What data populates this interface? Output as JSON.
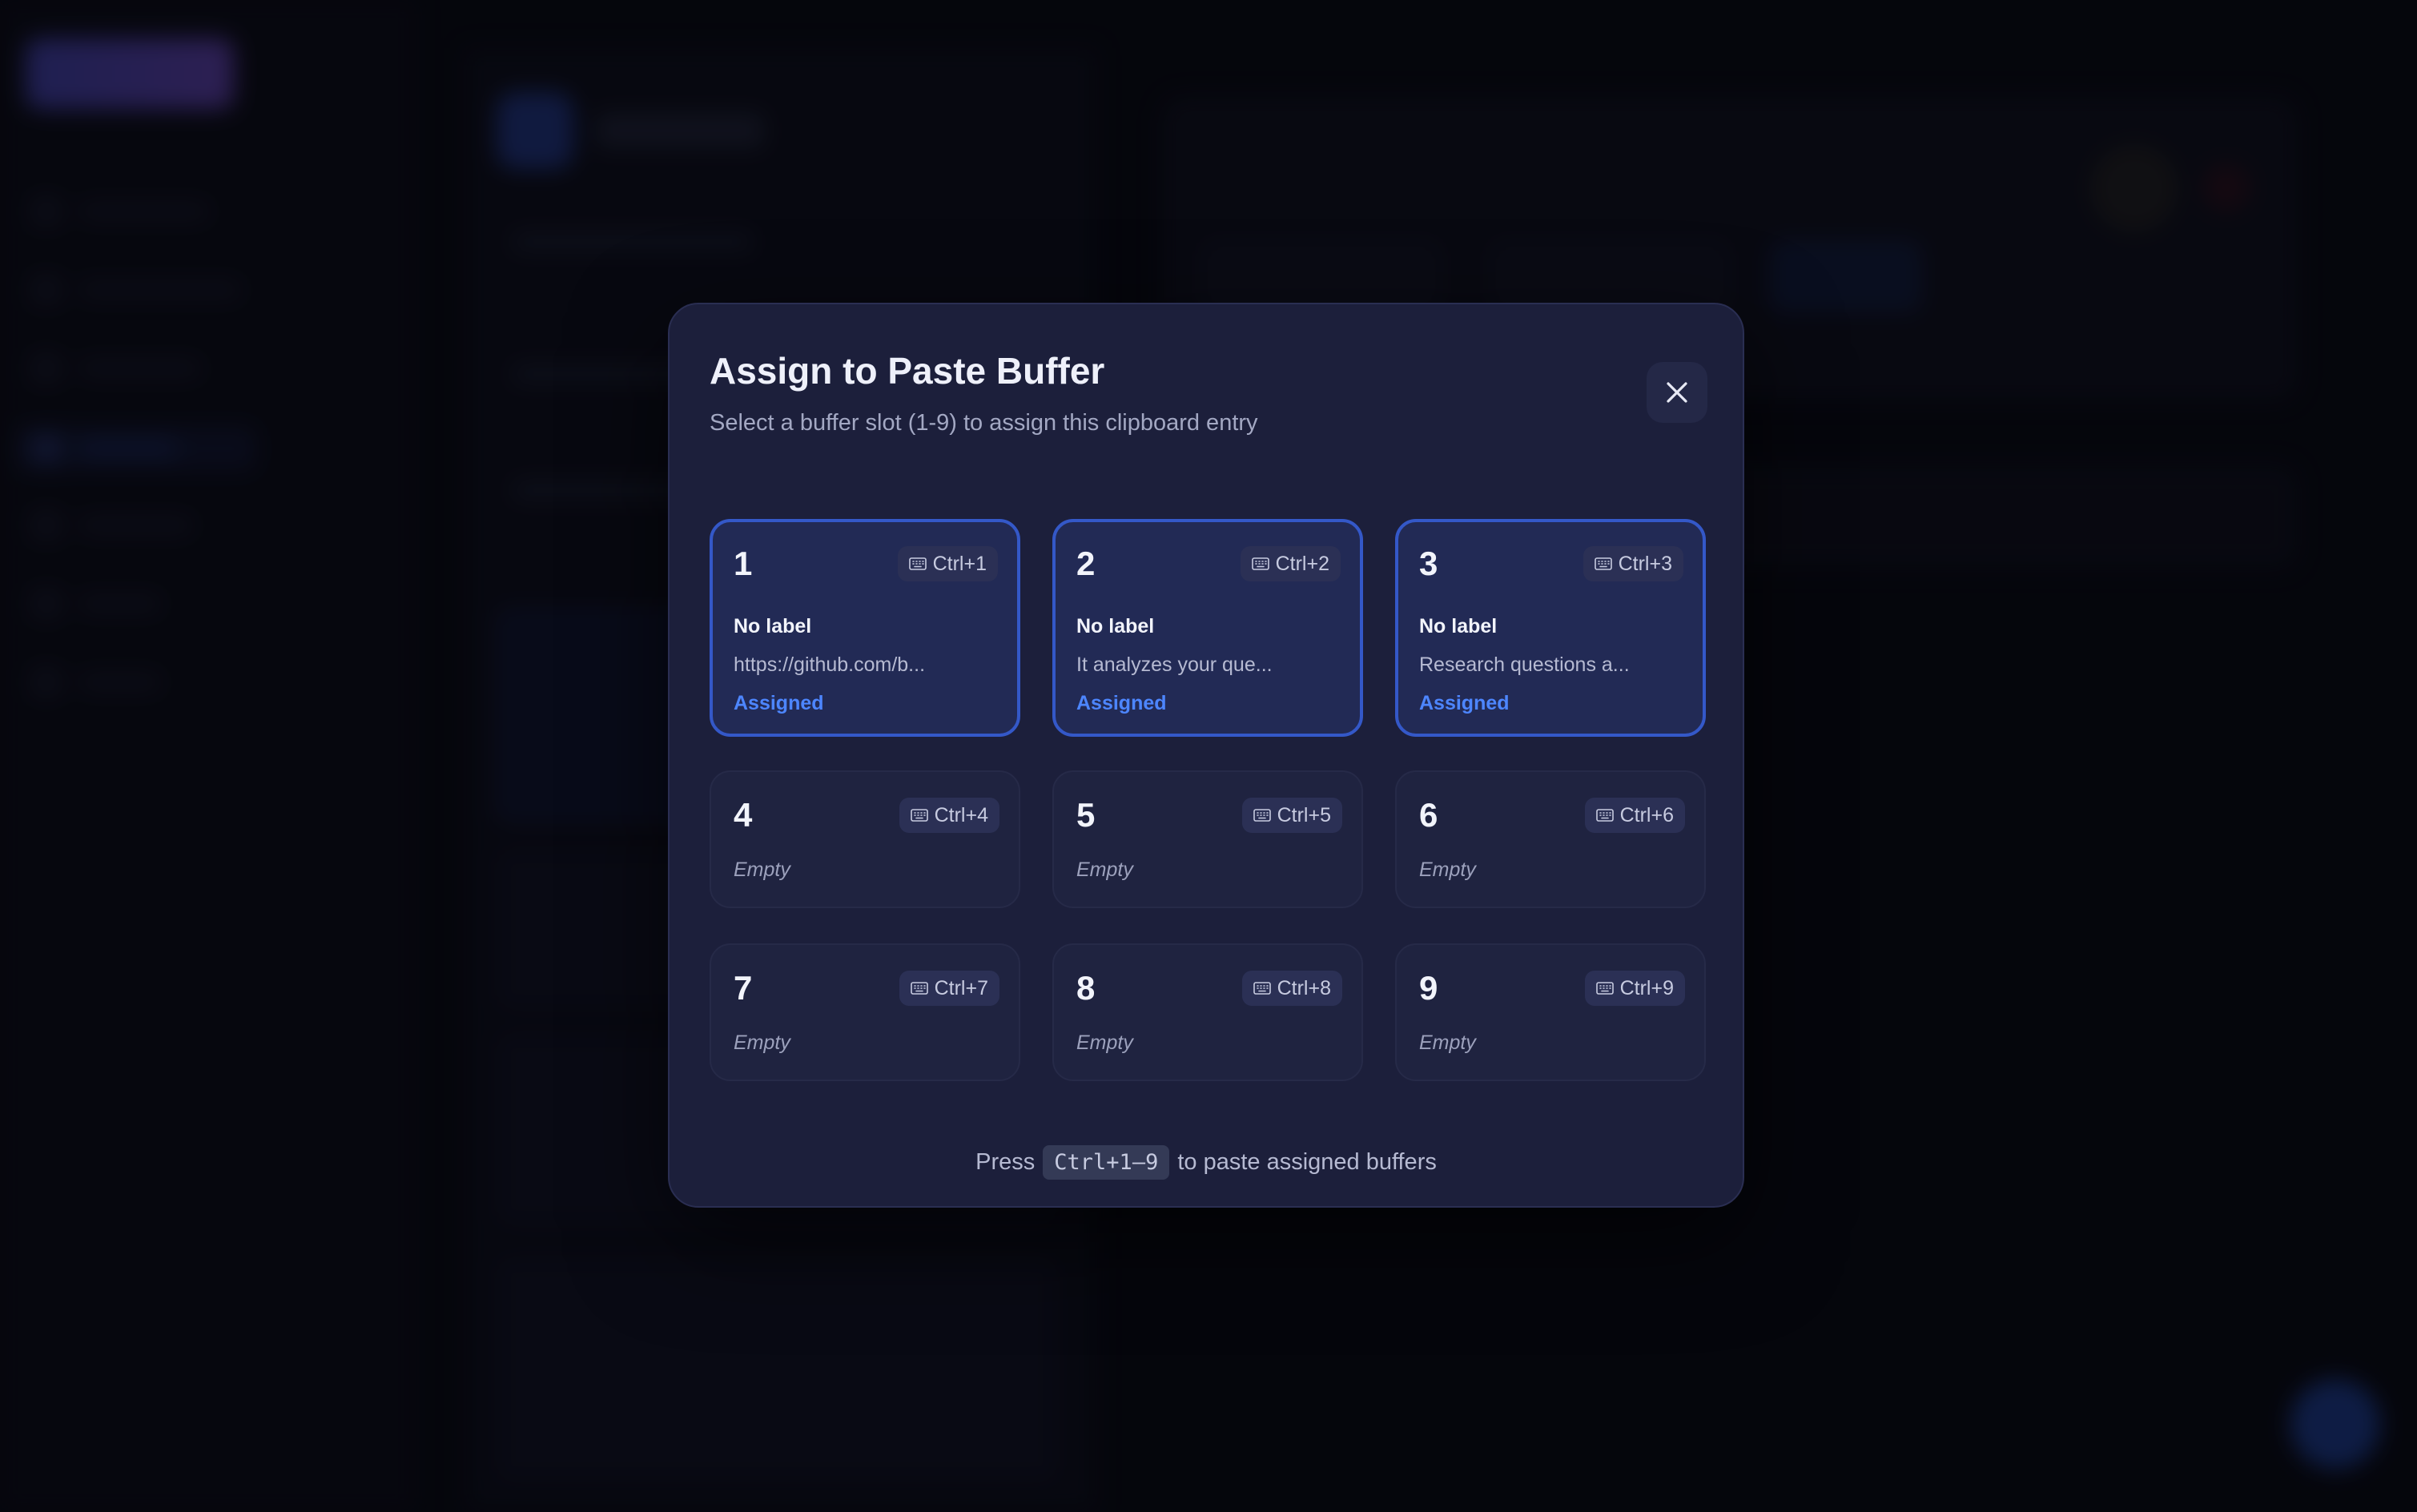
{
  "modal": {
    "title": "Assign to Paste Buffer",
    "subtitle": "Select a buffer slot (1-9) to assign this clipboard entry",
    "close_icon": "close-icon",
    "footer": {
      "prefix": "Press",
      "shortcut": "Ctrl+1–9",
      "suffix": "to paste assigned buffers"
    }
  },
  "slots": [
    {
      "number": "1",
      "shortcut": "Ctrl+1",
      "label": "No label",
      "preview": "https://github.com/b...",
      "status": "Assigned"
    },
    {
      "number": "2",
      "shortcut": "Ctrl+2",
      "label": "No label",
      "preview": "It analyzes your que...",
      "status": "Assigned"
    },
    {
      "number": "3",
      "shortcut": "Ctrl+3",
      "label": "No label",
      "preview": "Research questions a...",
      "status": "Assigned"
    },
    {
      "number": "4",
      "shortcut": "Ctrl+4",
      "empty_text": "Empty"
    },
    {
      "number": "5",
      "shortcut": "Ctrl+5",
      "empty_text": "Empty"
    },
    {
      "number": "6",
      "shortcut": "Ctrl+6",
      "empty_text": "Empty"
    },
    {
      "number": "7",
      "shortcut": "Ctrl+7",
      "empty_text": "Empty"
    },
    {
      "number": "8",
      "shortcut": "Ctrl+8",
      "empty_text": "Empty"
    },
    {
      "number": "9",
      "shortcut": "Ctrl+9",
      "empty_text": "Empty"
    }
  ],
  "colors": {
    "modal_bg": "#1c1f3b",
    "assigned_border": "#3458c8",
    "assigned_text": "#4d86ff",
    "overlay": "#07080e"
  },
  "icons": {
    "shortcut_badge": "keyboard-icon",
    "close": "close-icon"
  }
}
